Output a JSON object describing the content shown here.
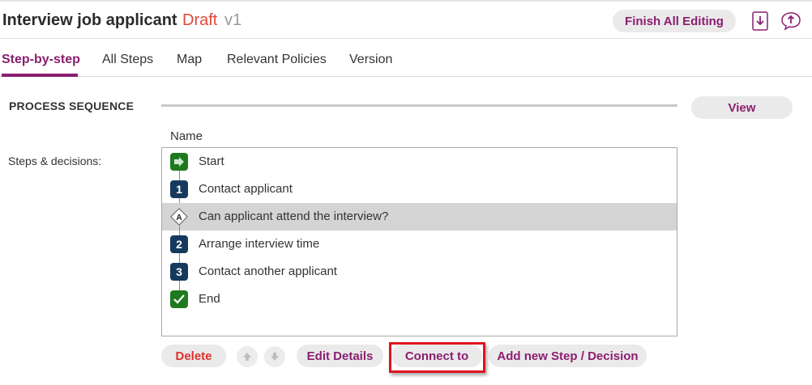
{
  "header": {
    "title": "Interview job applicant",
    "status": "Draft",
    "version": "v1",
    "finish_label": "Finish All Editing",
    "download_icon": "download-icon",
    "upload_icon": "upload-comment-icon"
  },
  "tabs": [
    {
      "label": "Step-by-step",
      "active": true
    },
    {
      "label": "All Steps",
      "active": false
    },
    {
      "label": "Map",
      "active": false
    },
    {
      "label": "Relevant Policies",
      "active": false
    },
    {
      "label": "Version",
      "active": false
    }
  ],
  "section": {
    "title": "PROCESS SEQUENCE",
    "view_label": "View"
  },
  "list": {
    "column_header": "Name",
    "field_label": "Steps & decisions:",
    "items": [
      {
        "type": "start",
        "badge": "",
        "label": "Start",
        "selected": false
      },
      {
        "type": "step",
        "badge": "1",
        "label": "Contact applicant",
        "selected": false
      },
      {
        "type": "decision",
        "badge": "A",
        "label": "Can applicant attend the interview?",
        "selected": true
      },
      {
        "type": "step",
        "badge": "2",
        "label": "Arrange interview time",
        "selected": false
      },
      {
        "type": "step",
        "badge": "3",
        "label": "Contact another applicant",
        "selected": false
      },
      {
        "type": "end",
        "badge": "",
        "label": "End",
        "selected": false
      }
    ]
  },
  "actions": {
    "delete_label": "Delete",
    "edit_label": "Edit Details",
    "connect_label": "Connect to",
    "add_label": "Add new Step / Decision"
  },
  "colors": {
    "accent": "#8b1e6f",
    "draft": "#e0493a",
    "delete": "#e0302a",
    "step_badge": "#153a5e",
    "green_badge": "#1f7a1f",
    "highlight": "#e0141e"
  }
}
